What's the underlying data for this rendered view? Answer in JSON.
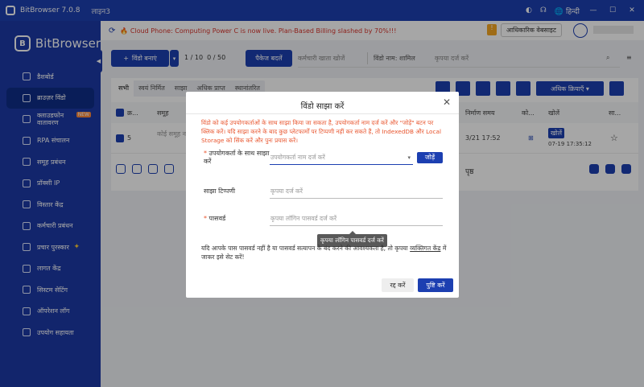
{
  "app": {
    "title": "BitBrowser 7.0.8",
    "license": "लाइन3"
  },
  "titlebar": {
    "lang": "हिन्दी"
  },
  "sidebar": {
    "brand": "BitBrowser",
    "items": [
      {
        "label": "डैशबोर्ड",
        "icon": "home-icon"
      },
      {
        "label": "ब्राउज़र विंडो",
        "icon": "browser-icon",
        "active": true
      },
      {
        "label": "क्लाउडफोन वातावरण",
        "icon": "phone-icon",
        "badge": "NEW"
      },
      {
        "label": "RPA संचालन",
        "icon": "rpa-icon"
      },
      {
        "label": "समूह प्रबंधन",
        "icon": "group-icon"
      },
      {
        "label": "प्रॉक्सी IP",
        "icon": "proxy-icon"
      },
      {
        "label": "विस्तार केंद्र",
        "icon": "extension-icon"
      },
      {
        "label": "कर्मचारी प्रबंधन",
        "icon": "staff-icon"
      },
      {
        "label": "प्रचार पुरस्कार",
        "icon": "reward-icon"
      },
      {
        "label": "लागत केंद्र",
        "icon": "cost-icon"
      },
      {
        "label": "सिस्टम सेटिंग",
        "icon": "settings-icon"
      },
      {
        "label": "ऑपरेशन लॉग",
        "icon": "log-icon"
      },
      {
        "label": "उपयोग सहायता",
        "icon": "help-icon"
      }
    ]
  },
  "topbar": {
    "notice": "🔥 Cloud Phone: Computing Power C is now live. Plan-Based Billing slashed by 70%!!!",
    "official_site": "आधिकारिक वेबसाइट"
  },
  "toolbar": {
    "create": "विंडो बनाएं",
    "count1": "1 / 10",
    "count2": "0 / 50",
    "package": "पैकेज बदलें",
    "staff_search": "कर्मचारी खाता खोजें",
    "filter": "विंडो नाम:",
    "filter_val": "शामिल",
    "search_ph": "कृपया दर्ज करें"
  },
  "tabs": [
    "सभी",
    "स्वयं निर्मित",
    "साझा",
    "अधिक प्राप्त",
    "स्थानांतरित"
  ],
  "more_actions": "अधिक क्रियाएँ",
  "table": {
    "headers": {
      "no": "क्र...",
      "group": "समूह",
      "created": "निर्माण समय",
      "platform": "को...",
      "open": "खोलें",
      "share": "सा..."
    },
    "row": {
      "no": "5",
      "group": "कोई समूह न...",
      "created": "3/21 17:52",
      "open_btn": "खोलें",
      "open_time": "07-19 17:35:12"
    }
  },
  "pager": {
    "page_label": "पृष्ठ"
  },
  "modal": {
    "title": "विंडो साझा करें",
    "warning": "विंडो को कई उपयोगकर्ताओं के साथ साझा किया जा सकता है, उपयोगकर्ता नाम दर्ज करें और \"जोड़ें\" बटन पर क्लिक करें। यदि साझा करने के बाद कुछ प्लेटफार्मों पर टिप्पणी नहीं कर सकते हैं, तो IndexedDB और Local Storage को सिंक करें और पुनः प्रयास करें।",
    "user_label": "उपयोगकर्ता के साथ साझा करें",
    "user_ph": "उपयोगकर्ता नाम दर्ज करें",
    "add": "जोड़ें",
    "note_label": "साझा टिप्पणी",
    "note_ph": "कृपया दर्ज करें",
    "pw_label": "पासवर्ड",
    "pw_ph": "कृपया लॉगिन पासवर्ड दर्ज करें",
    "tooltip": "कृपया लॉगिन पासवर्ड दर्ज करें",
    "hint_a": "यदि आपके पास पासवर्ड नहीं है या पासवर्ड सत्यापन के बंद करने की आवश्यकता है, तो कृपया",
    "hint_link": "व्यक्तिगत केंद्र",
    "hint_b": "में जाकर इसे सेट करें!",
    "cancel": "रद्द करें",
    "confirm": "पुष्टि करें"
  }
}
